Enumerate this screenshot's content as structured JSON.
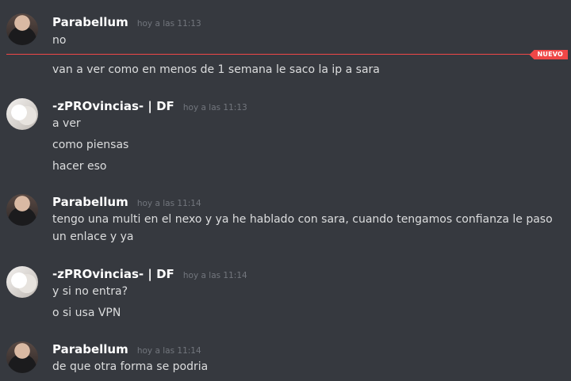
{
  "divider": {
    "badge": "NUEVO"
  },
  "messages": [
    {
      "username": "Parabellum",
      "timestamp": "hoy a las 11:13",
      "lines": [
        "no",
        "van a ver como en menos de 1 semana le saco la ip a sara"
      ]
    },
    {
      "username": "-zPROvincias- | DF",
      "timestamp": "hoy a las 11:13",
      "lines": [
        "a ver",
        "como piensas",
        "hacer eso"
      ]
    },
    {
      "username": "Parabellum",
      "timestamp": "hoy a las 11:14",
      "lines": [
        "tengo una multi en el nexo y ya he hablado con sara, cuando tengamos confianza le paso un enlace y ya"
      ]
    },
    {
      "username": "-zPROvincias- | DF",
      "timestamp": "hoy a las 11:14",
      "lines": [
        "y si no entra?",
        "o si usa VPN"
      ]
    },
    {
      "username": "Parabellum",
      "timestamp": "hoy a las 11:14",
      "lines": [
        "de que otra forma se podria"
      ]
    }
  ],
  "colors": {
    "background": "#36393f",
    "username": "#ffffff",
    "text": "#dcddde",
    "timestamp": "#72767d",
    "new_divider": "#f04747"
  }
}
